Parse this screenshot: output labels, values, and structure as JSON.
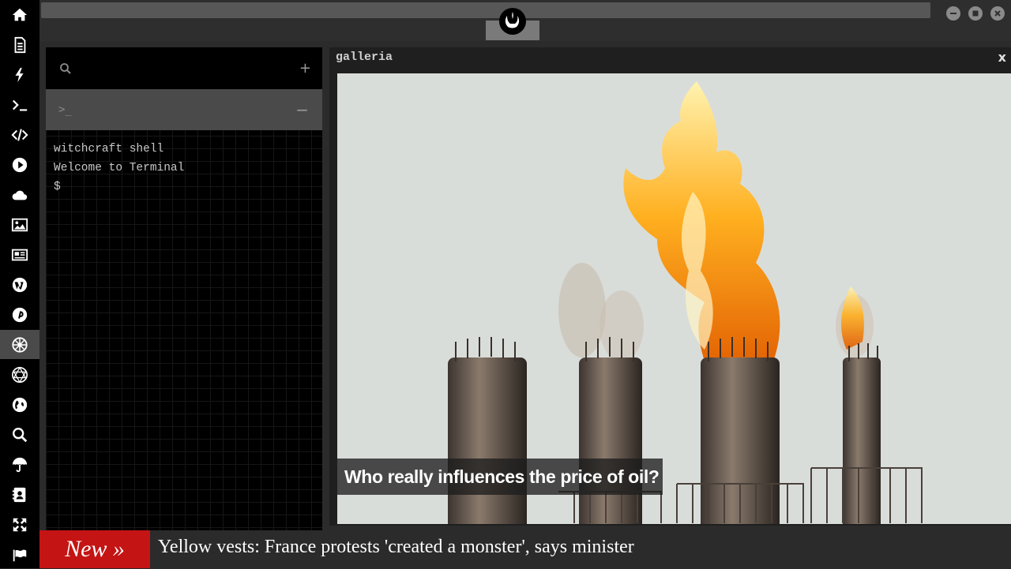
{
  "dock": {
    "items": [
      {
        "icon": "home-icon"
      },
      {
        "icon": "document-icon"
      },
      {
        "icon": "lightning-icon"
      },
      {
        "icon": "terminal-icon"
      },
      {
        "icon": "code-icon"
      },
      {
        "icon": "play-icon"
      },
      {
        "icon": "cloud-icon"
      },
      {
        "icon": "image-icon"
      },
      {
        "icon": "newspaper-icon"
      },
      {
        "icon": "wordpress-icon"
      },
      {
        "icon": "pinterest-icon"
      },
      {
        "icon": "galactic-empire-icon",
        "active": true
      },
      {
        "icon": "network-sphere-icon"
      },
      {
        "icon": "globe-icon"
      },
      {
        "icon": "search-icon"
      },
      {
        "icon": "umbrella-icon"
      },
      {
        "icon": "contact-card-icon"
      },
      {
        "icon": "expand-icon"
      },
      {
        "icon": "flag-icon"
      }
    ]
  },
  "titlebar": {
    "logo_icon": "rebel-alliance-icon",
    "window_buttons": [
      "minimize",
      "maximize",
      "close"
    ]
  },
  "terminal": {
    "search_icon": "search-icon",
    "add_label": "+",
    "tab_prompt": ">_",
    "collapse_label": "−",
    "lines": [
      "witchcraft shell",
      "Welcome to Terminal",
      "$"
    ]
  },
  "galleria": {
    "title": "galleria",
    "close_label": "x",
    "caption": "Who really influences the price of oil?"
  },
  "ticker": {
    "badge": "New »",
    "headline": "Yellow vests: France protests 'created a monster', says minister"
  },
  "colors": {
    "dock_bg": "#000000",
    "ticker_badge": "#c41414",
    "panel_bg": "#2b2b2b"
  }
}
